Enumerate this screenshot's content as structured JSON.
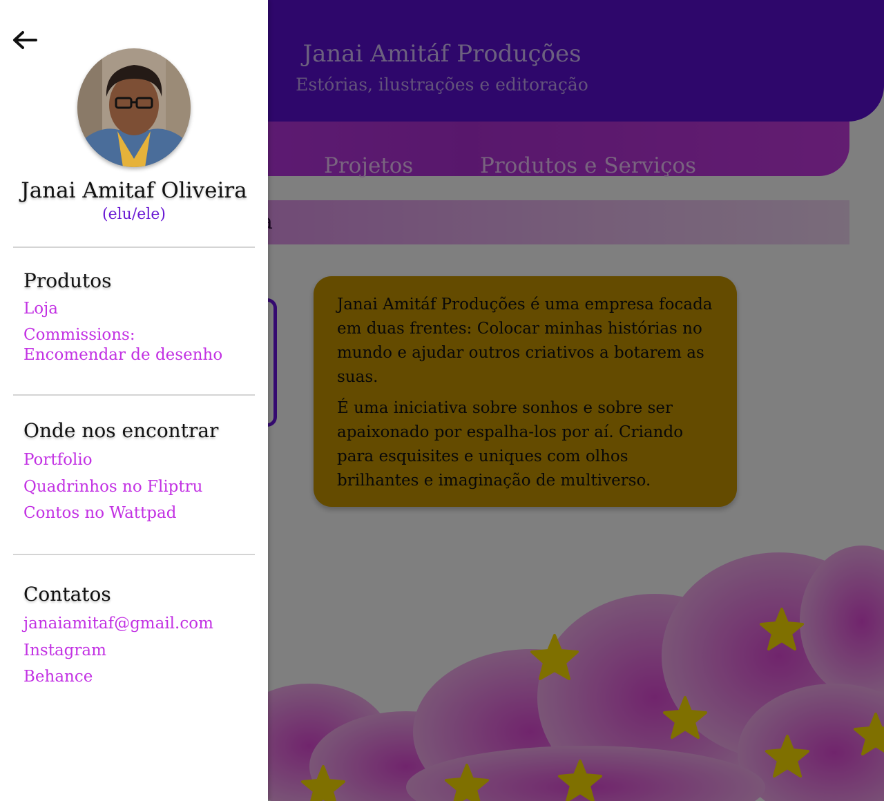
{
  "header": {
    "title": "Janai Amitáf Produções",
    "subtitle": "Estórias, ilustrações e editoração"
  },
  "nav": {
    "items": [
      {
        "label": "Projetos"
      },
      {
        "label": "Produtos e Serviços"
      }
    ]
  },
  "section": {
    "partial_label": "a"
  },
  "about": {
    "paragraphs": [
      "Janai Amitáf Produções é uma empresa focada em duas frentes: Colocar minhas histórias no mundo e ajudar outros criativos a botarem as suas.",
      "É uma iniciativa sobre sonhos e sobre ser apaixonado por espalha-los por aí. Criando para esquisites e uniques com olhos brilhantes e imaginação de multiverso."
    ]
  },
  "drawer": {
    "back_icon": "arrow-left-icon",
    "profile": {
      "name": "Janai Amitaf Oliveira",
      "pronouns": "(elu/ele)"
    },
    "groups": [
      {
        "title": "Produtos",
        "links": [
          {
            "label": "Loja"
          },
          {
            "label": "Commissions:"
          },
          {
            "label": "Encomendar de desenho"
          }
        ]
      },
      {
        "title": "Onde nos encontrar",
        "links": [
          {
            "label": "Portfolio"
          },
          {
            "label": "Quadrinhos no Fliptru"
          },
          {
            "label": "Contos no Wattpad"
          }
        ]
      },
      {
        "title": "Contatos",
        "links": [
          {
            "label": "janaiamitaf@gmail.com"
          },
          {
            "label": "Instagram"
          },
          {
            "label": "Behance"
          }
        ]
      }
    ]
  },
  "colors": {
    "header": "#5c0fd6",
    "nav": "#c43ff0",
    "card": "#c99700",
    "link": "#c231e3",
    "pronouns": "#6a1ad4",
    "overlay": "rgba(0,0,0,0.5)"
  }
}
